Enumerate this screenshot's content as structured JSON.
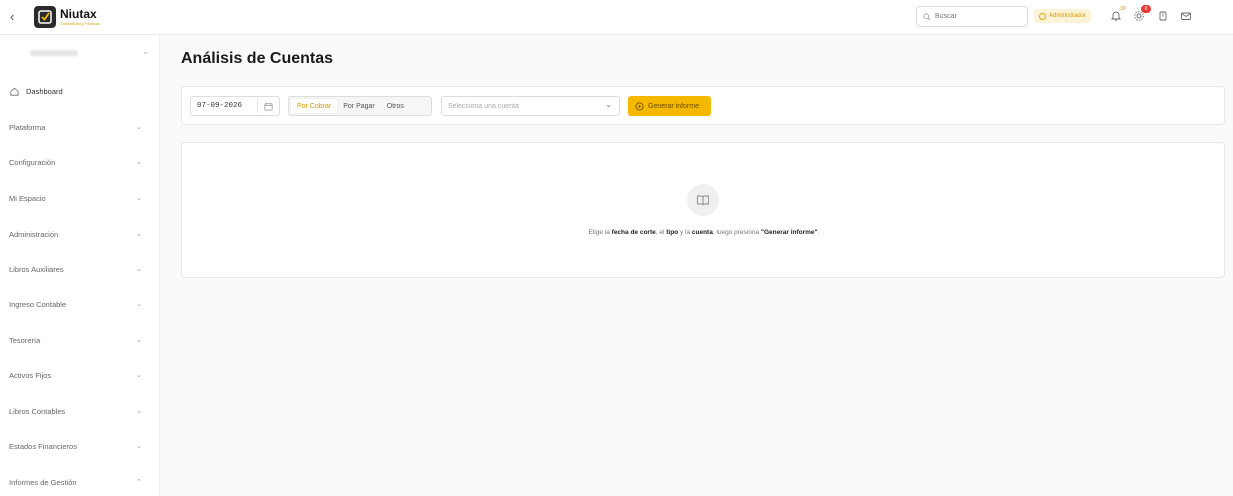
{
  "brand": {
    "name": "Niutax",
    "tagline": "Contabilidad y Finanzas"
  },
  "topbar": {
    "search_placeholder": "Buscar",
    "role": "Administrador",
    "notifications_count": "30",
    "alerts_count": "0"
  },
  "sidebar": {
    "items": [
      {
        "label": "Dashboard"
      },
      {
        "label": "Plataforma"
      },
      {
        "label": "Configuración"
      },
      {
        "label": "Mi Espacio"
      },
      {
        "label": "Administración"
      },
      {
        "label": "Libros Auxiliares"
      },
      {
        "label": "Ingreso Contable"
      },
      {
        "label": "Tesorería"
      },
      {
        "label": "Activos Fijos"
      },
      {
        "label": "Libros Contables"
      },
      {
        "label": "Estados Financieros"
      },
      {
        "label": "Informes de Gestión"
      }
    ]
  },
  "main": {
    "title": "Análisis de Cuentas",
    "filters": {
      "date": "07-09-2026",
      "type_options": [
        "Por Cobrar",
        "Por Pagar",
        "Otros"
      ],
      "selected_type": "Por Cobrar",
      "account_placeholder": "Selecciona una cuenta",
      "generate_label": "Generar informe"
    },
    "empty_state": {
      "part1": "Elige la ",
      "bold1": "fecha de corte",
      "part2": ", el ",
      "bold2": "tipo",
      "part3": " y la ",
      "bold3": "cuenta",
      "part4": ", luego presiona ",
      "bold4": "\"Generar informe\"",
      "part5": "."
    }
  },
  "colors": {
    "accent": "#f5b800",
    "accent_text": "#d49a00"
  }
}
